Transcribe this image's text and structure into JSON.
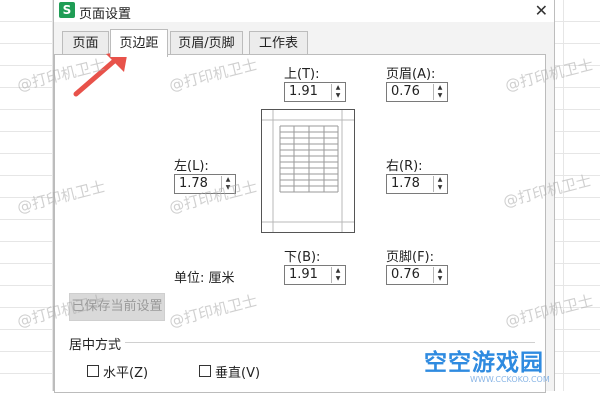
{
  "dialog": {
    "app_icon": "S",
    "title": "页面设置",
    "close_glyph": "✕"
  },
  "tabs": [
    {
      "label": "页面",
      "active": false
    },
    {
      "label": "页边距",
      "active": true
    },
    {
      "label": "页眉/页脚",
      "active": false
    },
    {
      "label": "工作表",
      "active": false
    }
  ],
  "margins": {
    "top": {
      "label": "上(T):",
      "value": "1.91"
    },
    "header": {
      "label": "页眉(A):",
      "value": "0.76"
    },
    "left": {
      "label": "左(L):",
      "value": "1.78"
    },
    "right": {
      "label": "右(R):",
      "value": "1.78"
    },
    "bottom": {
      "label": "下(B):",
      "value": "1.91"
    },
    "footer": {
      "label": "页脚(F):",
      "value": "0.76"
    }
  },
  "unit": {
    "label": "单位:",
    "value": "厘米"
  },
  "save_button": "已保存当前设置",
  "center": {
    "heading": "居中方式",
    "horizontal": {
      "label": "水平(Z)",
      "checked": false
    },
    "vertical": {
      "label": "垂直(V)",
      "checked": false
    }
  },
  "watermarks": [
    "@打印机卫士"
  ],
  "brand": {
    "name": "空空游戏园",
    "url": "WWW.CCKOKO.COM"
  },
  "colors": {
    "accent_arrow": "#e8524a",
    "brand_blue": "#2f8be0"
  },
  "icons": {
    "spin_up": "▲",
    "spin_down": "▼"
  }
}
